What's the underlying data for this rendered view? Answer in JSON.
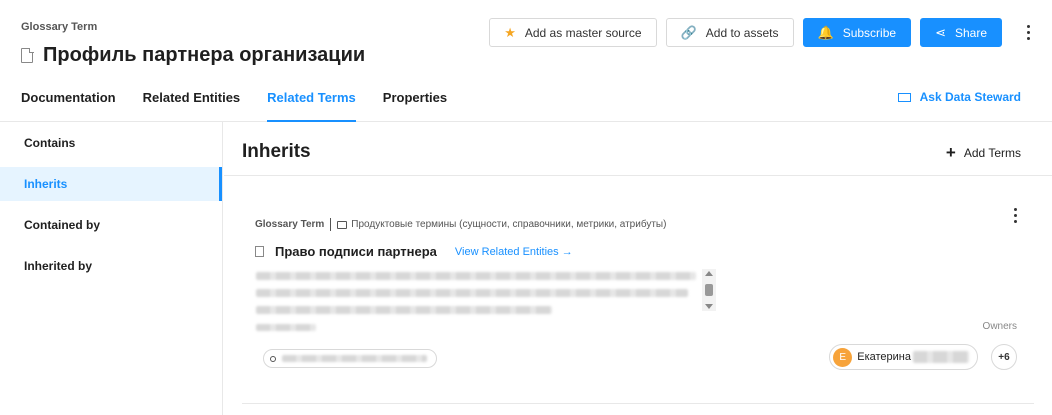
{
  "header": {
    "entity_type": "Glossary Term",
    "title": "Профиль партнера организации"
  },
  "actions": {
    "master_source_label": "Add as master source",
    "add_assets_label": "Add to assets",
    "subscribe_label": "Subscribe",
    "share_label": "Share"
  },
  "tabs": [
    {
      "label": "Documentation"
    },
    {
      "label": "Related Entities"
    },
    {
      "label": "Related Terms"
    },
    {
      "label": "Properties"
    }
  ],
  "active_tab": "Related Terms",
  "ask_steward_label": "Ask Data Steward",
  "sidebar": {
    "items": [
      {
        "label": "Contains"
      },
      {
        "label": "Inherits"
      },
      {
        "label": "Contained by"
      },
      {
        "label": "Inherited by"
      }
    ],
    "active": "Inherits"
  },
  "main": {
    "section_title": "Inherits",
    "add_terms_label": "Add Terms"
  },
  "card": {
    "entity_type": "Glossary Term",
    "path": "Продуктовые термины (сущности, справочники, метрики, атрибуты)",
    "name": "Право подписи партнера",
    "view_related_label": "View Related Entities →",
    "owners_label": "Owners",
    "owner": {
      "initial": "E",
      "name": "Екатерина"
    },
    "owners_more": "+6"
  },
  "colors": {
    "accent": "#1890ff",
    "avatar": "#f7a33a"
  }
}
